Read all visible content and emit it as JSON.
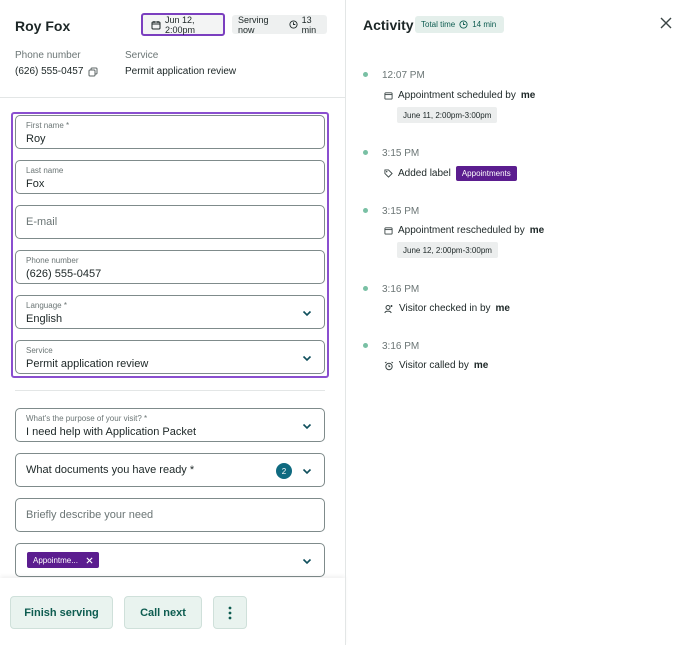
{
  "visitor": {
    "name": "Roy Fox",
    "date_chip": "Jun 12, 2:00pm",
    "serving_label": "Serving now",
    "serving_time": "13 min"
  },
  "info": {
    "phone_label": "Phone number",
    "phone_value": "(626) 555-0457",
    "service_label": "Service",
    "service_value": "Permit application review"
  },
  "form": {
    "first_name": {
      "label": "First name *",
      "value": "Roy"
    },
    "last_name": {
      "label": "Last name",
      "value": "Fox"
    },
    "email": {
      "placeholder": "E-mail"
    },
    "phone": {
      "label": "Phone number",
      "value": "(626) 555-0457"
    },
    "language": {
      "label": "Language *",
      "value": "English"
    },
    "service": {
      "label": "Service",
      "value": "Permit application review"
    },
    "purpose": {
      "label": "What's the purpose of your visit? *",
      "value": "I need help with Application Packet"
    },
    "documents": {
      "placeholder": "What documents you have ready *",
      "count": "2"
    },
    "describe": {
      "placeholder": "Briefly describe your need"
    },
    "labels": {
      "tag": "Appointme..."
    }
  },
  "footer": {
    "finish": "Finish serving",
    "call_next": "Call next"
  },
  "activity": {
    "title": "Activity",
    "total_label": "Total time",
    "total_value": "14 min",
    "events": [
      {
        "time": "12:07 PM",
        "text": "Appointment scheduled by",
        "actor": "me",
        "chip": "June 11, 2:00pm-3:00pm"
      },
      {
        "time": "3:15 PM",
        "text": "Added label",
        "label": "Appointments"
      },
      {
        "time": "3:15 PM",
        "text": "Appointment rescheduled by",
        "actor": "me",
        "chip": "June 12, 2:00pm-3:00pm"
      },
      {
        "time": "3:16 PM",
        "text": "Visitor checked in by",
        "actor": "me"
      },
      {
        "time": "3:16 PM",
        "text": "Visitor called by",
        "actor": "me"
      }
    ]
  },
  "colors": {
    "accent_purple": "#8a4fcf",
    "label_purple": "#5b1d8f",
    "teal": "#0d5c50",
    "timeline_dot": "#79c0a4"
  }
}
